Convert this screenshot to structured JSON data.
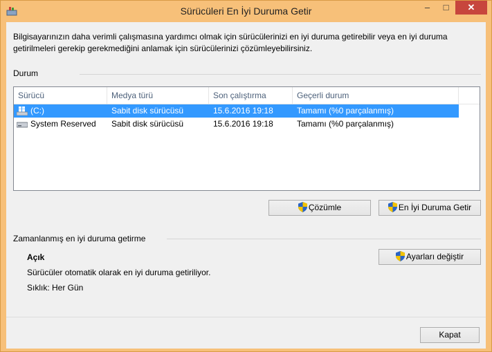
{
  "window": {
    "title": "Sürücüleri En İyi Duruma Getir",
    "controls": {
      "minimize": "–",
      "maximize": "□",
      "close": "✕"
    }
  },
  "description": "Bilgisayarınızın daha verimli çalışmasına yardımcı olmak için sürücülerinizi en iyi duruma getirebilir veya en iyi duruma getirilmeleri gerekip gerekmediğini anlamak için sürücülerinizi çözümleyebilirsiniz.",
  "status_section": {
    "label": "Durum",
    "columns": [
      "Sürücü",
      "Medya türü",
      "Son çalıştırma",
      "Geçerli durum"
    ],
    "rows": [
      {
        "drive": "(C:)",
        "media": "Sabit disk sürücüsü",
        "last_run": "15.6.2016 19:18",
        "state": "Tamamı (%0 parçalanmış)",
        "selected": true,
        "icon": "windows-drive-icon"
      },
      {
        "drive": "System Reserved",
        "media": "Sabit disk sürücüsü",
        "last_run": "15.6.2016 19:18",
        "state": "Tamamı (%0 parçalanmış)",
        "selected": false,
        "icon": "hard-drive-icon"
      }
    ]
  },
  "buttons": {
    "analyze": "Çözümle",
    "optimize": "En İyi Duruma Getir",
    "change_settings": "Ayarları değiştir",
    "close": "Kapat"
  },
  "schedule_section": {
    "label": "Zamanlanmış en iyi duruma getirme",
    "state": "Açık",
    "text": "Sürücüler otomatik olarak en iyi duruma getiriliyor.",
    "frequency": "Sıklık: Her Gün"
  },
  "colors": {
    "frame": "#f7c079",
    "selection": "#3399ff",
    "close_button": "#c7463d"
  }
}
